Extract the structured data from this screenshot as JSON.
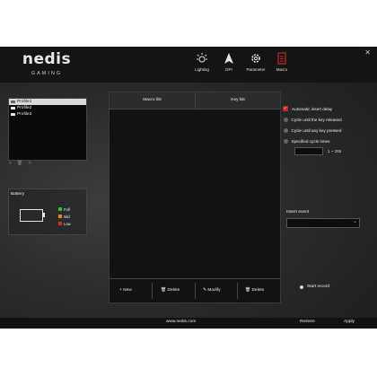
{
  "app": {
    "logo_text": "nedis",
    "logo_sub": "GAMING",
    "close_label": "✕"
  },
  "nav": [
    {
      "label": "Lighting",
      "icon": "lighting-icon"
    },
    {
      "label": "DPI",
      "icon": "dpi-icon"
    },
    {
      "label": "Parameter",
      "icon": "gear-icon"
    },
    {
      "label": "Macro",
      "icon": "macro-icon",
      "active": true,
      "active_color": "#c0282a"
    }
  ],
  "profiles": {
    "items": [
      "Profile1",
      "Profile2",
      "Profile3"
    ],
    "selected": "Profile1",
    "tools": [
      "+",
      "🗑",
      "✎"
    ]
  },
  "battery": {
    "title": "Battery",
    "legend": [
      {
        "label": "Full",
        "color": "#2fbf3a"
      },
      {
        "label": "Mid",
        "color": "#e08a1e"
      },
      {
        "label": "Low",
        "color": "#d8282a"
      }
    ]
  },
  "macro": {
    "col_macro_list": "Macro list",
    "col_key_list": "Key list",
    "buttons": [
      {
        "icon": "+",
        "label": "New"
      },
      {
        "icon": "🗑",
        "label": "Delete"
      },
      {
        "icon": "✎",
        "label": "Modify"
      },
      {
        "icon": "🗑",
        "label": "Delete"
      }
    ]
  },
  "options": {
    "auto_insert_delay": "Automatic insert delay",
    "auto_insert_delay_checked": true,
    "cycle_until_released": "Cycle until the key released",
    "cycle_until_any": "Cycle until any key pressed",
    "specified_cycle": "Specified cycle times",
    "cycle_range": "1 ~ 255",
    "cycle_value": "",
    "insert_event_label": "Insert event",
    "insert_event_value": "",
    "start_record": "Start record"
  },
  "footer": {
    "url": "www.nedis.com",
    "restore": "Restore",
    "apply": "Apply"
  }
}
